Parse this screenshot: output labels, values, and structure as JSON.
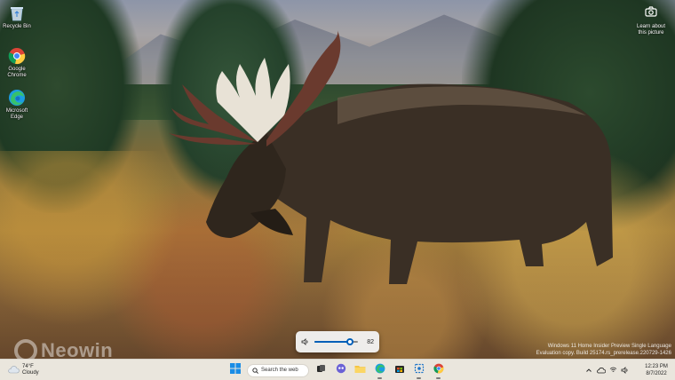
{
  "desktop": {
    "icons": [
      {
        "label": "Recycle Bin",
        "icon": "recycle-bin-icon"
      },
      {
        "label": "Google\nChrome",
        "icon": "chrome-icon"
      },
      {
        "label": "Microsoft\nEdge",
        "icon": "edge-icon"
      }
    ],
    "learn_about": {
      "label": "Learn about\nthis picture",
      "icon": "camera-icon"
    }
  },
  "watermark": {
    "line1": "Windows 11 Home Insider Preview Single Language",
    "line2": "Evaluation copy. Build 25174.rs_prerelease.220729-1426"
  },
  "brand_watermark": "Neowin",
  "volume_flyout": {
    "level": 82,
    "level_text": "82",
    "icon": "speaker-icon"
  },
  "taskbar": {
    "weather": {
      "temp": "74°F",
      "condition": "Cloudy",
      "icon": "cloud-icon"
    },
    "start_icon": "windows-start-icon",
    "search_placeholder": "Search the web",
    "apps": [
      {
        "name": "task-view",
        "icon": "task-view-icon"
      },
      {
        "name": "chat",
        "icon": "chat-icon"
      },
      {
        "name": "file-explorer",
        "icon": "folder-icon"
      },
      {
        "name": "edge",
        "icon": "edge-icon"
      },
      {
        "name": "store",
        "icon": "store-icon"
      },
      {
        "name": "snipping-tool",
        "icon": "snipping-tool-icon"
      },
      {
        "name": "chrome",
        "icon": "chrome-icon"
      }
    ],
    "tray": {
      "icons": [
        "chevron-up-icon",
        "onedrive-icon",
        "network-icon",
        "speaker-icon"
      ]
    },
    "clock": {
      "time": "12:23 PM",
      "date": "8/7/2022"
    }
  },
  "colors": {
    "accent": "#005fb8",
    "taskbar": "#eeeae2"
  }
}
